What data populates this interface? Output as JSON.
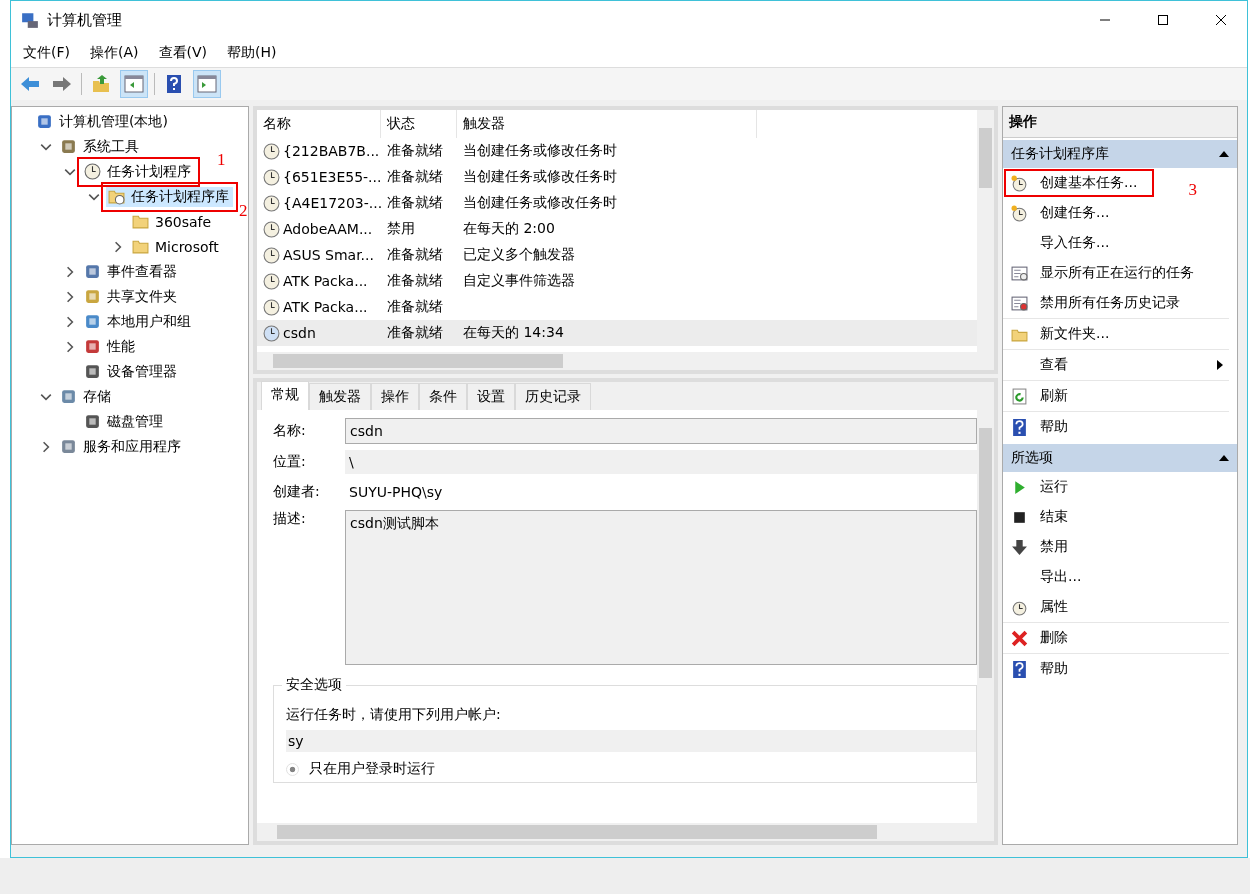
{
  "window": {
    "title": "计算机管理"
  },
  "menu": [
    "文件(F)",
    "操作(A)",
    "查看(V)",
    "帮助(H)"
  ],
  "toolbar": [
    {
      "kind": "back",
      "disabled": false
    },
    {
      "kind": "forward",
      "disabled": true
    },
    {
      "kind": "sep"
    },
    {
      "kind": "up",
      "disabled": false
    },
    {
      "kind": "panel",
      "selected": true
    },
    {
      "kind": "sep"
    },
    {
      "kind": "help",
      "disabled": false
    },
    {
      "kind": "panel2",
      "selected": true
    }
  ],
  "tree": [
    {
      "label": "计算机管理(本地)",
      "kind": "computer",
      "children": [
        {
          "label": "系统工具",
          "kind": "tools",
          "expanded": true,
          "children": [
            {
              "label": "任务计划程序",
              "kind": "clock",
              "expanded": true,
              "annotation": "1",
              "children": [
                {
                  "label": "任务计划程序库",
                  "kind": "folderclock",
                  "expanded": true,
                  "selected": true,
                  "annotation": "2",
                  "children": [
                    {
                      "label": "360safe",
                      "kind": "folder"
                    },
                    {
                      "label": "Microsoft",
                      "kind": "folder",
                      "expanded": false
                    }
                  ]
                }
              ]
            },
            {
              "label": "事件查看器",
              "kind": "book",
              "expanded": false
            },
            {
              "label": "共享文件夹",
              "kind": "share",
              "expanded": false
            },
            {
              "label": "本地用户和组",
              "kind": "users",
              "expanded": false
            },
            {
              "label": "性能",
              "kind": "perf",
              "expanded": false
            },
            {
              "label": "设备管理器",
              "kind": "device"
            }
          ]
        },
        {
          "label": "存储",
          "kind": "storage",
          "expanded": true,
          "children": [
            {
              "label": "磁盘管理",
              "kind": "disk"
            }
          ]
        },
        {
          "label": "服务和应用程序",
          "kind": "services",
          "expanded": false
        }
      ]
    }
  ],
  "table": {
    "columns": [
      "名称",
      "状态",
      "触发器"
    ],
    "rows": [
      {
        "name": "{212BAB7B...",
        "status": "准备就绪",
        "trigger": "当创建任务或修改任务时",
        "selected": false
      },
      {
        "name": "{651E3E55-...",
        "status": "准备就绪",
        "trigger": "当创建任务或修改任务时",
        "selected": false
      },
      {
        "name": "{A4E17203-...",
        "status": "准备就绪",
        "trigger": "当创建任务或修改任务时",
        "selected": false
      },
      {
        "name": "AdobeAAM...",
        "status": "禁用",
        "trigger": "在每天的 2:00",
        "selected": false
      },
      {
        "name": "ASUS Smar...",
        "status": "准备就绪",
        "trigger": "已定义多个触发器",
        "selected": false
      },
      {
        "name": "ATK Packa...",
        "status": "准备就绪",
        "trigger": "自定义事件筛选器",
        "selected": false
      },
      {
        "name": "ATK Packa...",
        "status": "准备就绪",
        "selected": false
      },
      {
        "name": "csdn",
        "status": "准备就绪",
        "trigger": "在每天的 14:34",
        "selected": true
      }
    ]
  },
  "detail": {
    "tabs": [
      {
        "label": "常规",
        "selected": true
      },
      {
        "label": "触发器",
        "selected": false
      },
      {
        "label": "操作",
        "selected": false
      },
      {
        "label": "条件",
        "selected": false
      },
      {
        "label": "设置",
        "selected": false
      },
      {
        "label": "历史记录",
        "selected": false
      }
    ],
    "name_label": "名称:",
    "name": "csdn",
    "location_label": "位置:",
    "location": "\\",
    "author_label": "创建者:",
    "author": "SUYU-PHQ\\sy",
    "description_label": "描述:",
    "description": "csdn测试脚本",
    "security": {
      "title": "安全选项",
      "prompt": "运行任务时，请使用下列用户帐户:",
      "user": "sy",
      "options": [
        {
          "label": "只在用户登录时运行",
          "checked": true,
          "disabled": true
        }
      ]
    }
  },
  "actions": {
    "title": "操作",
    "sections": [
      {
        "title": "任务计划程序库",
        "expanded": true,
        "items": [
          {
            "label": "创建基本任务...",
            "kind": "basictask",
            "annotation": "3"
          },
          {
            "label": "创建任务...",
            "kind": "task"
          },
          {
            "label": "导入任务..."
          },
          {
            "label": "显示所有正在运行的任务",
            "kind": "running"
          },
          {
            "label": "禁用所有任务历史记录",
            "kind": "history",
            "divider": true
          },
          {
            "label": "新文件夹...",
            "kind": "folder",
            "divider": true
          },
          {
            "label": "查看",
            "submenu": true,
            "divider": true
          },
          {
            "label": "刷新",
            "kind": "refresh",
            "divider": true
          },
          {
            "label": "帮助",
            "kind": "help"
          }
        ]
      },
      {
        "title": "所选项",
        "expanded": true,
        "items": [
          {
            "label": "运行",
            "kind": "run"
          },
          {
            "label": "结束",
            "kind": "stop"
          },
          {
            "label": "禁用",
            "kind": "disable"
          },
          {
            "label": "导出..."
          },
          {
            "label": "属性",
            "kind": "props",
            "divider": true
          },
          {
            "label": "删除",
            "kind": "delete",
            "divider": true
          },
          {
            "label": "帮助",
            "kind": "help"
          }
        ]
      }
    ]
  }
}
